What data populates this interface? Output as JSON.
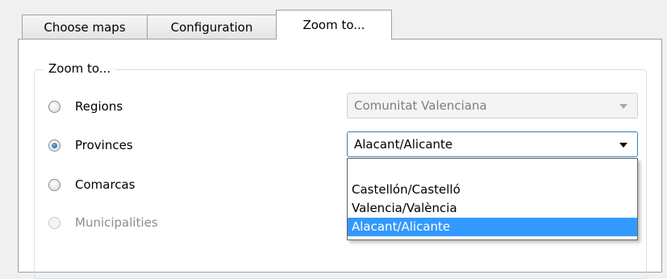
{
  "tabs": [
    {
      "label": "Choose maps",
      "active": false
    },
    {
      "label": "Configuration",
      "active": false
    },
    {
      "label": "Zoom to...",
      "active": true
    }
  ],
  "group": {
    "title": "Zoom to..."
  },
  "options": [
    {
      "label": "Regions",
      "checked": false,
      "enabled": true
    },
    {
      "label": "Provinces",
      "checked": true,
      "enabled": true
    },
    {
      "label": "Comarcas",
      "checked": false,
      "enabled": true
    },
    {
      "label": "Municipalities",
      "checked": false,
      "enabled": false
    }
  ],
  "regions_combo": {
    "value": "Comunitat Valenciana",
    "enabled": false
  },
  "provinces_combo": {
    "value": "Alacant/Alicante",
    "open": true,
    "options": [
      "Castellón/Castelló",
      "Valencia/València",
      "Alacant/Alicante"
    ],
    "selected_option": "Alacant/Alicante"
  },
  "colors": {
    "selection": "#3399ff",
    "focus_border": "#3c7fb1"
  }
}
